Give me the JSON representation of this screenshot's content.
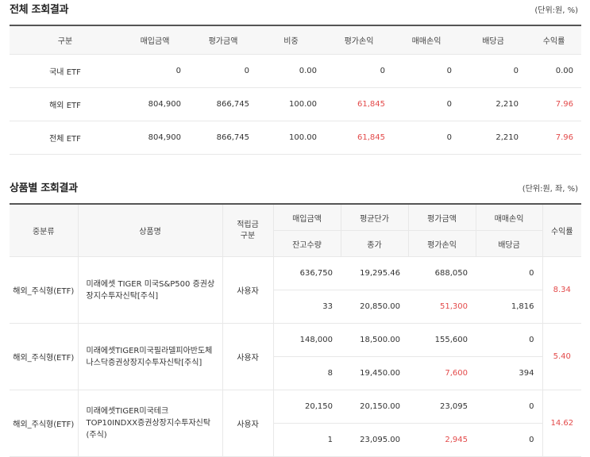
{
  "section1": {
    "title": "전체 조회결과",
    "unit": "(단위:원, %)",
    "headers": [
      "구분",
      "매입금액",
      "평가금액",
      "비중",
      "평가손익",
      "매매손익",
      "배당금",
      "수익률"
    ],
    "rows": [
      {
        "label": "국내 ETF",
        "buy": "0",
        "eval": "0",
        "weight": "0.00",
        "eval_pl": "0",
        "trade_pl": "0",
        "dividend": "0",
        "rate": "0.00"
      },
      {
        "label": "해외 ETF",
        "buy": "804,900",
        "eval": "866,745",
        "weight": "100.00",
        "eval_pl": "61,845",
        "trade_pl": "0",
        "dividend": "2,210",
        "rate": "7.96"
      },
      {
        "label": "전체 ETF",
        "buy": "804,900",
        "eval": "866,745",
        "weight": "100.00",
        "eval_pl": "61,845",
        "trade_pl": "0",
        "dividend": "2,210",
        "rate": "7.96"
      }
    ]
  },
  "section2": {
    "title": "상품별 조회결과",
    "unit": "(단위:원, 좌, %)",
    "headers": {
      "category": "중분류",
      "product": "상품명",
      "type": "적립금 구분",
      "buy": "매입금액",
      "avg_price": "평균단가",
      "eval": "평가금액",
      "trade_pl": "매매손익",
      "rate": "수익률",
      "qty": "잔고수량",
      "close": "종가",
      "eval_pl": "평가손익",
      "dividend": "배당금"
    },
    "rows": [
      {
        "category": "해외_주식형(ETF)",
        "product": "미래에셋 TIGER 미국S&P500 증권상장지수투자신탁[주식]",
        "type": "사용자",
        "buy": "636,750",
        "avg_price": "19,295.46",
        "eval": "688,050",
        "trade_pl": "0",
        "qty": "33",
        "close": "20,850.00",
        "eval_pl": "51,300",
        "dividend": "1,816",
        "rate": "8.34"
      },
      {
        "category": "해외_주식형(ETF)",
        "product": "미래에셋TIGER미국필라델피아반도체나스닥증권상장지수투자신탁[주식]",
        "type": "사용자",
        "buy": "148,000",
        "avg_price": "18,500.00",
        "eval": "155,600",
        "trade_pl": "0",
        "qty": "8",
        "close": "19,450.00",
        "eval_pl": "7,600",
        "dividend": "394",
        "rate": "5.40"
      },
      {
        "category": "해외_주식형(ETF)",
        "product": "미래에셋TIGER미국테크TOP10INDXX증권상장지수투자신탁(주식)",
        "type": "사용자",
        "buy": "20,150",
        "avg_price": "20,150.00",
        "eval": "23,095",
        "trade_pl": "0",
        "qty": "1",
        "close": "23,095.00",
        "eval_pl": "2,945",
        "dividend": "0",
        "rate": "14.62"
      }
    ]
  },
  "colors": {
    "positive": "#e34a4a",
    "header_bg": "#f7f7f7",
    "border": "#e8e8e8"
  }
}
